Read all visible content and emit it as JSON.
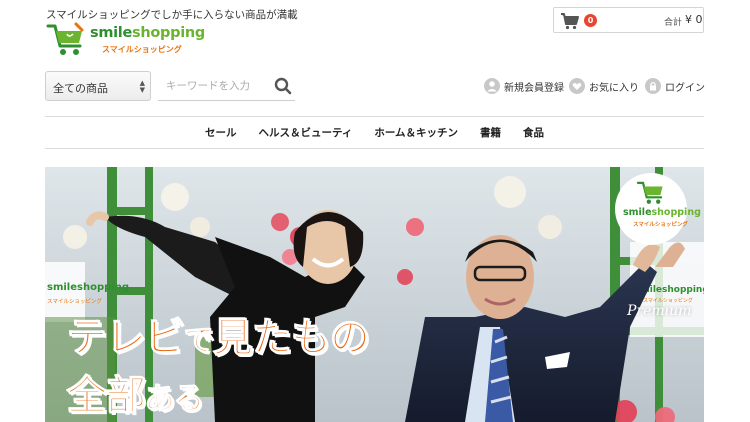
{
  "header": {
    "tagline": "スマイルショッピングでしか手に入らない商品が満載",
    "logo": {
      "word_part1": "smile",
      "word_part2": "shopping",
      "sub": "スマイルショッピング"
    }
  },
  "cart": {
    "icon": "cart-icon",
    "count": "0",
    "total_label": "合計",
    "total_value": "¥ 0"
  },
  "search": {
    "category_selected": "全ての商品",
    "placeholder": "キーワードを入力",
    "icon": "search-icon"
  },
  "user_links": [
    {
      "label": "新規会員登録",
      "icon": "user-icon"
    },
    {
      "label": "お気に入り",
      "icon": "heart-icon"
    },
    {
      "label": "ログイン",
      "icon": "lock-icon"
    }
  ],
  "nav": [
    "セール",
    "ヘルス＆ビューティ",
    "ホーム＆キッチン",
    "書籍",
    "食品"
  ],
  "hero": {
    "headline_part1": "テレビ",
    "headline_part2": "で",
    "headline_part3": "見たもの",
    "headline_part4": "全部",
    "headline_part5": "ある",
    "badge_word1": "smile",
    "badge_word2": "shopping",
    "badge_sub": "スマイルショッピング",
    "sign_text": "Premium",
    "sign_brand": "smileshopping",
    "sign_brand_sub": "スマイルショッピング"
  },
  "colors": {
    "accent_orange": "#e8670e",
    "brand_green": "#2f8f2f",
    "badge_red": "#e9442f"
  }
}
